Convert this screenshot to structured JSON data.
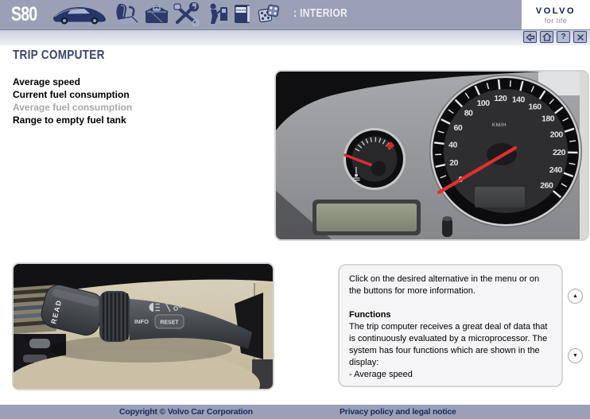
{
  "header": {
    "model": "S80",
    "section": ": INTERIOR",
    "brand": {
      "name": "VOLVO",
      "tagline": "for life"
    },
    "book_label": "VOLVO"
  },
  "toolbar": {
    "help_glyph": "?"
  },
  "page": {
    "title": "TRIP COMPUTER"
  },
  "menu": {
    "items": [
      {
        "label": "Average speed",
        "enabled": true
      },
      {
        "label": "Current fuel consumption",
        "enabled": true
      },
      {
        "label": "Average fuel consumption",
        "enabled": false
      },
      {
        "label": "Range to empty fuel tank",
        "enabled": true
      }
    ]
  },
  "cluster": {
    "unit_label": "KM/H",
    "speedo_labels": [
      "0",
      "20",
      "40",
      "60",
      "80",
      "100",
      "120",
      "140",
      "160",
      "180",
      "200",
      "220",
      "240",
      "260"
    ]
  },
  "stalk": {
    "read_label": "READ",
    "info_label": "INFO",
    "reset_label": "RESET"
  },
  "info_panel": {
    "intro": "Click on the desired alternative in the menu or on the buttons for more information.",
    "functions_heading": "Functions",
    "functions_body": "The trip computer receives a great deal of data that is continuously evaluated by a microprocessor. The system has four functions which are shown in the display:",
    "functions_item": "- Average speed"
  },
  "footer": {
    "copyright": "Copyright © Volvo Car Corporation",
    "privacy": "Privacy policy and legal notice"
  },
  "colors": {
    "header_bar": "#9aa0b6",
    "toolbar_bar": "#ccd0dd",
    "footer_bar": "#9aa0b6",
    "heading": "#3a4468",
    "icon_navy": "#2d3a69",
    "needle_red": "#e03030"
  }
}
